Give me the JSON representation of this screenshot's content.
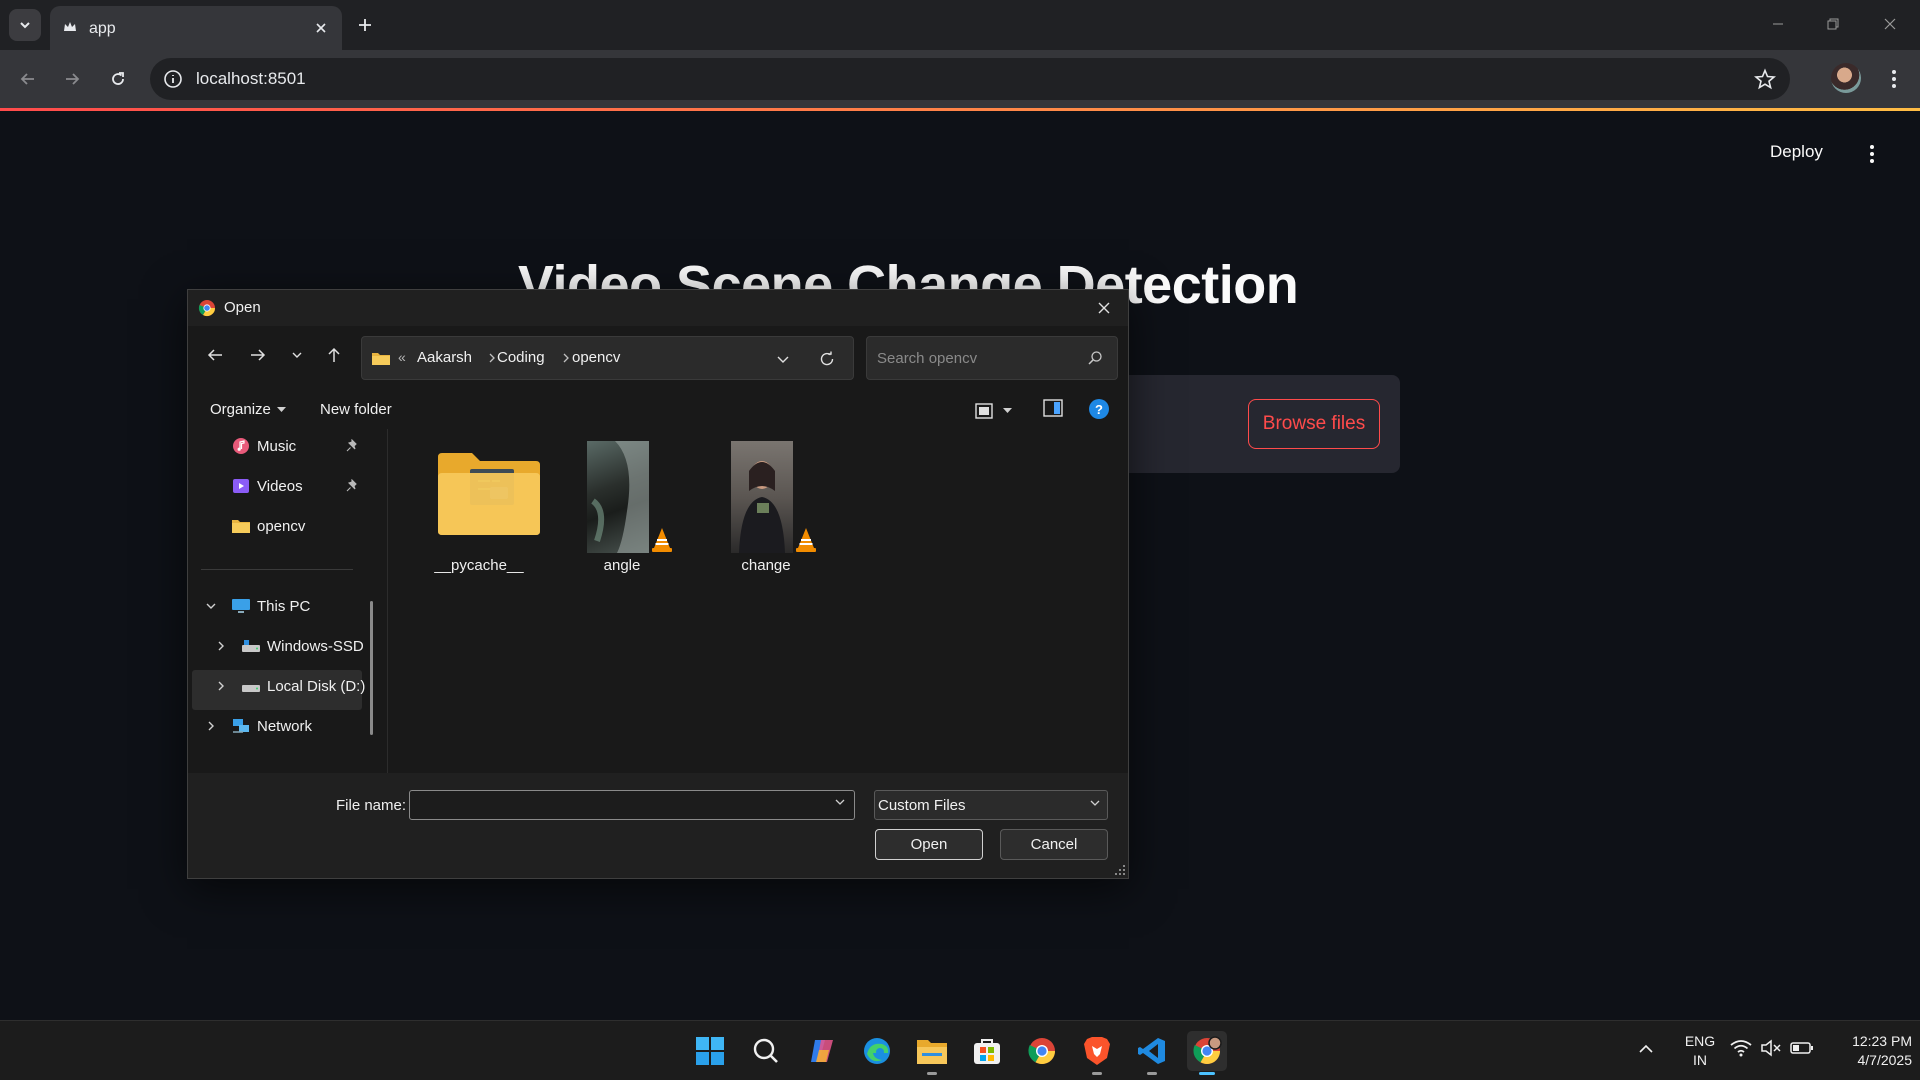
{
  "browser": {
    "tab_title": "app",
    "url": "localhost:8501",
    "accent_gradient": [
      "#ff4b4b",
      "#ffbd45"
    ]
  },
  "page": {
    "deploy_label": "Deploy",
    "title": "Video Scene Change Detection",
    "browse_label": "Browse files",
    "accent": "#ff4b4b"
  },
  "dialog": {
    "title": "Open",
    "breadcrumb": [
      "Aakarsh",
      "Coding",
      "opencv"
    ],
    "overflow_marker": "«",
    "search_placeholder": "Search opencv",
    "organize_label": "Organize",
    "new_folder_label": "New folder",
    "help_glyph": "?",
    "nav": {
      "quick_access": [
        {
          "label": "Music",
          "icon": "music-icon",
          "pinned": true
        },
        {
          "label": "Videos",
          "icon": "videos-icon",
          "pinned": true
        },
        {
          "label": "opencv",
          "icon": "folder-icon",
          "pinned": false
        }
      ],
      "this_pc": "This PC",
      "drives": [
        {
          "label": "Windows-SSD",
          "icon": "drive-icon"
        },
        {
          "label": "Local Disk (D:)",
          "icon": "drive-icon"
        }
      ],
      "network": "Network"
    },
    "files": [
      {
        "name": "__pycache__",
        "type": "folder"
      },
      {
        "name": "angle",
        "type": "video"
      },
      {
        "name": "change",
        "type": "video"
      }
    ],
    "file_name_label": "File name:",
    "file_name_value": "",
    "filter_value": "Custom Files",
    "open_label": "Open",
    "cancel_label": "Cancel"
  },
  "taskbar": {
    "apps": [
      "start-icon",
      "search-icon",
      "copilot-icon",
      "edge-icon",
      "file-explorer-icon",
      "store-icon",
      "chrome-icon",
      "brave-icon",
      "vscode-icon",
      "chrome-profile-icon"
    ],
    "lang_line1": "ENG",
    "lang_line2": "IN",
    "time": "12:23 PM",
    "date": "4/7/2025"
  }
}
